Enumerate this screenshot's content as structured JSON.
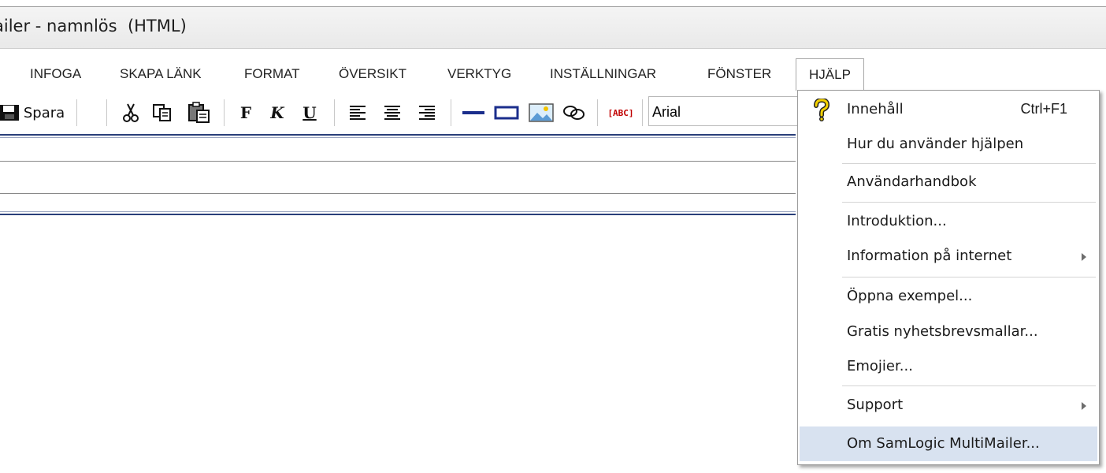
{
  "window": {
    "title": "ailer - namnlös  (HTML)"
  },
  "menubar": {
    "items": [
      "INFOGA",
      "SKAPA LÄNK",
      "FORMAT",
      "ÖVERSIKT",
      "VERKTYG",
      "INSTÄLLNINGAR",
      "FÖNSTER",
      "HJÄLP"
    ],
    "open_menu": "HJÄLP"
  },
  "toolbar": {
    "save_label": "Spara",
    "font_name": "Arial",
    "bold_label": "F",
    "italic_label": "K",
    "underline_label": "U",
    "spell_label": "[ABC]",
    "icons": [
      "save-icon",
      "cut-icon",
      "copy-icon",
      "paste-icon",
      "bold-icon",
      "italic-icon",
      "underline-icon",
      "align-left-icon",
      "align-center-icon",
      "align-right-icon",
      "horizontal-line-icon",
      "rectangle-icon",
      "image-icon",
      "link-icon",
      "spellcheck-icon"
    ]
  },
  "help_menu": {
    "items": [
      {
        "label": "Innehåll",
        "shortcut": "Ctrl+F1",
        "icon": "help-icon"
      },
      {
        "label": "Hur du använder hjälpen"
      },
      {
        "label": "Användarhandbok"
      },
      {
        "label": "Introduktion..."
      },
      {
        "label": "Information på internet",
        "submenu": true
      },
      {
        "label": "Öppna exempel..."
      },
      {
        "label": "Gratis nyhetsbrevsmallar..."
      },
      {
        "label": "Emojier..."
      },
      {
        "label": "Support",
        "submenu": true
      },
      {
        "label": "Om SamLogic MultiMailer...",
        "highlighted": true
      }
    ]
  },
  "colors": {
    "highlight": "#d8e2f0",
    "rule_blue": "#2a3f7a"
  }
}
